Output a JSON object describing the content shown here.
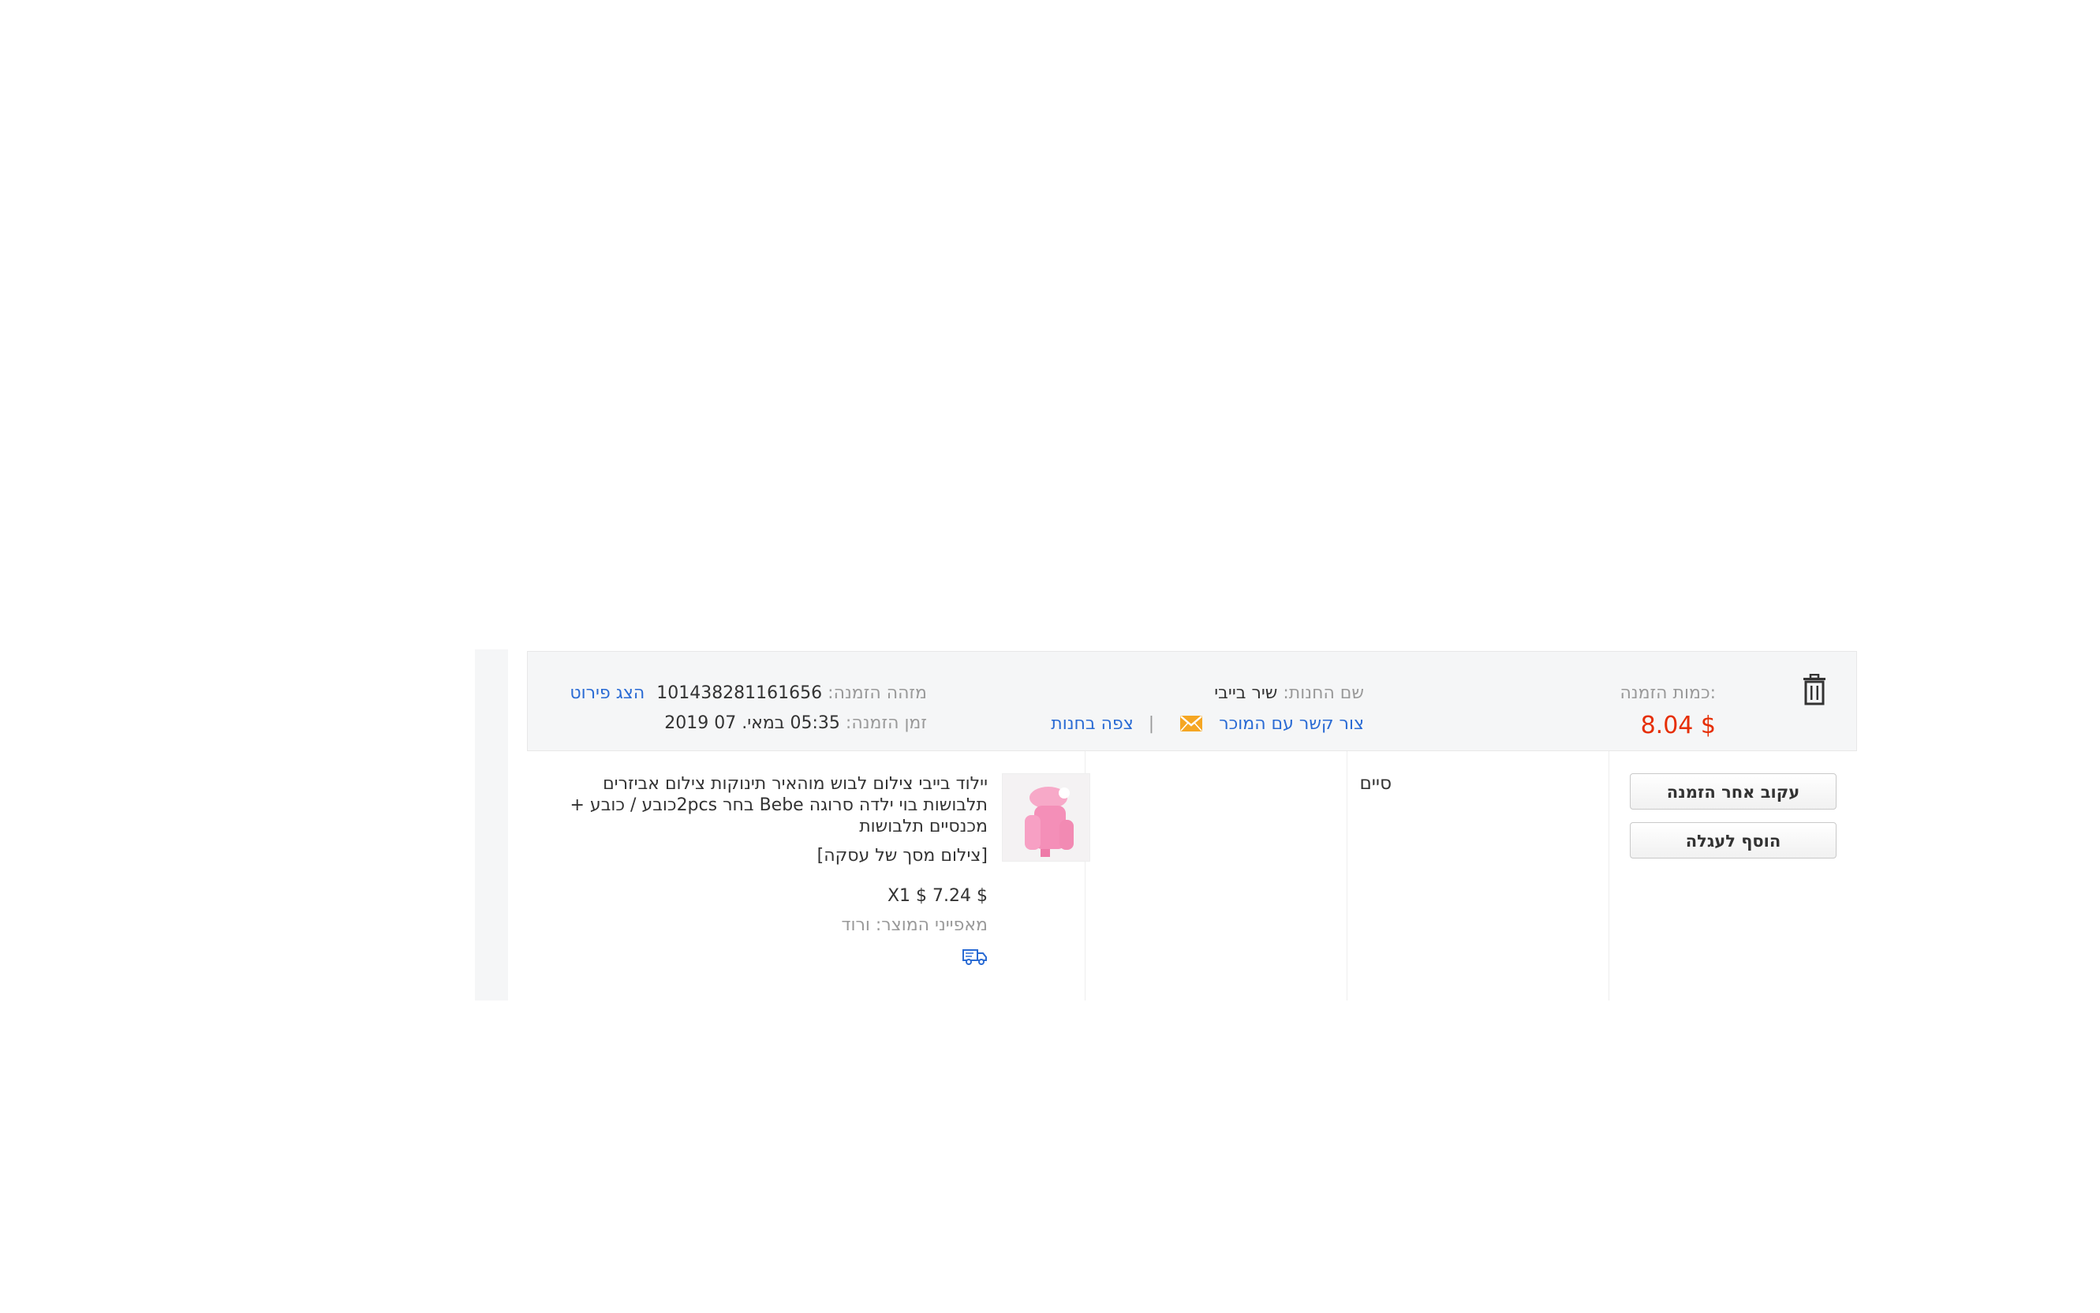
{
  "order": {
    "amount_label": ":כמות הזמנה",
    "amount_value": "$ 8.04",
    "store_label": "שם החנות:",
    "store_name": "שיר בייבי",
    "contact_seller": "צור קשר עם המוכר",
    "view_store": "צפה בחנות",
    "separator": "|",
    "order_id_label": "מזהה הזמנה:",
    "order_id": "101438281161656",
    "view_details": "הצג פירוט",
    "order_time_label": "זמן הזמנה:",
    "order_time": "05:35 במאי. 07 2019"
  },
  "actions": {
    "track": "עקוב אחר הזמנה",
    "add_to_cart": "הוסף לעגלה"
  },
  "status": "סיים",
  "product": {
    "title": "יילוד בייבי צילום לבוש מוהאיר תינוקות צילום אביזרים תלבושות בוי ילדה סרוגה Bebe בחר 2pcsכובע / כובע + מכנסיים תלבושות",
    "tag": "[צילום מסך של עסקה]",
    "price_line": "$ 7.24 $ X1",
    "attributes": "מאפייני המוצר: ורוד"
  },
  "colors": {
    "price_red": "#e62e04",
    "link_blue": "#2a6bd4",
    "header_bg": "#f5f6f7"
  },
  "icons": [
    "trash-icon",
    "envelope-icon",
    "product-thumbnail",
    "shipping-truck-icon"
  ]
}
